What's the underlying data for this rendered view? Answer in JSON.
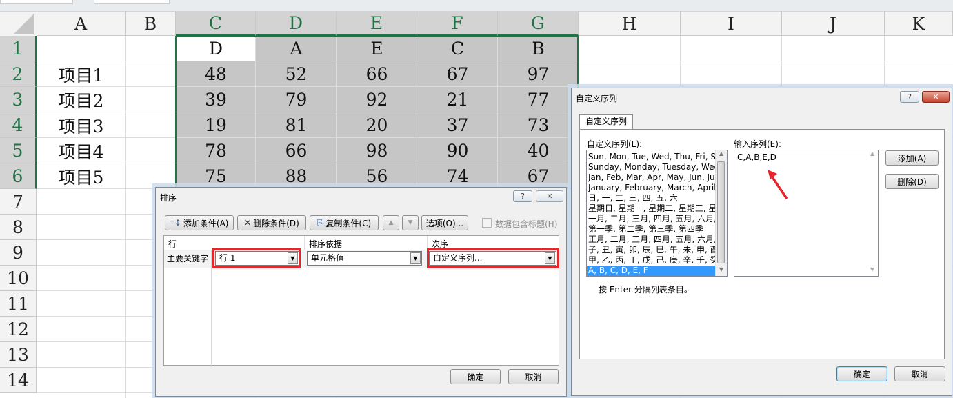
{
  "sheet": {
    "columns": [
      "A",
      "B",
      "C",
      "D",
      "E",
      "F",
      "G",
      "H",
      "I",
      "J",
      "K"
    ],
    "rows": [
      "1",
      "2",
      "3",
      "4",
      "5",
      "6",
      "7",
      "8",
      "9",
      "10",
      "11",
      "12",
      "13",
      "14"
    ],
    "header_row": [
      "D",
      "A",
      "E",
      "C",
      "B"
    ],
    "labels": [
      "项目1",
      "项目2",
      "项目3",
      "项目4",
      "项目5"
    ],
    "values": [
      [
        "48",
        "52",
        "66",
        "67",
        "97"
      ],
      [
        "39",
        "79",
        "92",
        "21",
        "77"
      ],
      [
        "19",
        "81",
        "20",
        "37",
        "73"
      ],
      [
        "78",
        "66",
        "98",
        "90",
        "40"
      ],
      [
        "75",
        "88",
        "56",
        "74",
        "67"
      ]
    ]
  },
  "sort_dialog": {
    "title": "排序",
    "help": "?",
    "close": "✕",
    "add_level": "添加条件(A)",
    "delete_level": "删除条件(D)",
    "copy_level": "复制条件(C)",
    "options": "选项(O)...",
    "header_checkbox": "数据包含标题(H)",
    "col_row": "行",
    "col_sort_on": "排序依据",
    "col_order": "次序",
    "primary_key": "主要关键字",
    "row_value": "行 1",
    "sort_on_value": "单元格值",
    "order_value": "自定义序列...",
    "ok": "确定",
    "cancel": "取消"
  },
  "custom_dialog": {
    "title": "自定义序列",
    "help": "?",
    "close": "✕",
    "tab": "自定义序列",
    "lists_label": "自定义序列(L):",
    "entries_label": "输入序列(E):",
    "lists": [
      "Sun, Mon, Tue, Wed, Thu, Fri, S",
      "Sunday, Monday, Tuesday, Wed",
      "Jan, Feb, Mar, Apr, May, Jun, Ju",
      "January, February, March, April,",
      "日, 一, 二, 三, 四, 五, 六",
      "星期日, 星期一, 星期二, 星期三, 星",
      "一月, 二月, 三月, 四月, 五月, 六月,",
      "第一季, 第二季, 第三季, 第四季",
      "正月, 二月, 三月, 四月, 五月, 六月,",
      "子, 丑, 寅, 卯, 辰, 巳, 午, 未, 申, 酉",
      "甲, 乙, 丙, 丁, 戊, 己, 庚, 辛, 壬, 癸",
      "A, B, C, D, E, F"
    ],
    "entries_value": "C,A,B,E,D",
    "add_button": "添加(A)",
    "delete_button": "删除(D)",
    "hint": "按 Enter 分隔列表条目。",
    "ok": "确定",
    "cancel": "取消"
  },
  "colors": {
    "selection_accent": "#217346",
    "highlight_red": "#e5262b",
    "list_selected": "#3399ff"
  }
}
